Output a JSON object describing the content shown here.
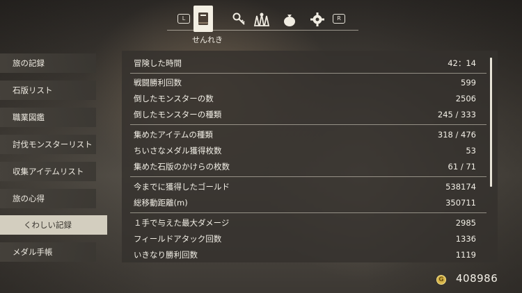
{
  "tabs": {
    "left_key": "L",
    "right_key": "R",
    "items": [
      {
        "icon": "book-icon",
        "active": true
      },
      {
        "icon": "key-icon",
        "active": false
      },
      {
        "icon": "party-icon",
        "active": false
      },
      {
        "icon": "bag-icon",
        "active": false
      },
      {
        "icon": "gear-icon",
        "active": false
      }
    ],
    "active_caption": "せんれき"
  },
  "sidebar": {
    "items": [
      {
        "label": "旅の記録"
      },
      {
        "label": "石版リスト"
      },
      {
        "label": "職業図鑑"
      },
      {
        "label": "討伐モンスターリスト"
      },
      {
        "label": "収集アイテムリスト"
      },
      {
        "label": "旅の心得"
      },
      {
        "label": "くわしい記録",
        "active": true
      },
      {
        "label": "メダル手帳"
      }
    ]
  },
  "records": [
    {
      "label": "冒険した時間",
      "value": "42：14"
    },
    {
      "label": "戦闘勝利回数",
      "value": "599"
    },
    {
      "label": "倒したモンスターの数",
      "value": "2506"
    },
    {
      "label": "倒したモンスターの種類",
      "value": "245 / 333"
    },
    {
      "label": "集めたアイテムの種類",
      "value": "318 / 476"
    },
    {
      "label": "ちいさなメダル獲得枚数",
      "value": "53"
    },
    {
      "label": "集めた石版のかけらの枚数",
      "value": "61 / 71"
    },
    {
      "label": "今までに獲得したゴールド",
      "value": "538174"
    },
    {
      "label": "総移動距離(m)",
      "value": "350711"
    },
    {
      "label": "１手で与えた最大ダメージ",
      "value": "2985"
    },
    {
      "label": "フィールドアタック回数",
      "value": "1336"
    },
    {
      "label": "いきなり勝利回数",
      "value": "1119"
    }
  ],
  "gold": {
    "coin_symbol": "G",
    "value": "408986"
  },
  "colors": {
    "accent": "#f3efe3",
    "coin": "#d7b54a"
  }
}
